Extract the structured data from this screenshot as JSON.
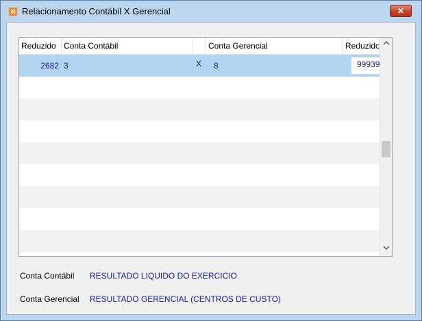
{
  "window": {
    "title": "Relacionamento Contábil X Gerencial",
    "close_label": "✕"
  },
  "grid": {
    "columns": [
      "Reduzido",
      "Conta Contábil",
      "",
      "Conta Gerencial",
      "Reduzido"
    ],
    "selected_row": {
      "reduzido": "2682",
      "conta_contabil": "3",
      "separator": "X",
      "conta_gerencial": "8",
      "reduzido_gerencial": "99939"
    }
  },
  "details": {
    "conta_contabil_label": "Conta Contábil",
    "conta_contabil_value": "RESULTADO LIQUIDO DO EXERCICIO",
    "conta_gerencial_label": "Conta Gerencial",
    "conta_gerencial_value": "RESULTADO GERENCIAL (CENTROS DE CUSTO)"
  },
  "icons": {
    "app": "app-logo-icon",
    "close": "close-icon",
    "scroll_up": "chevron-up-icon",
    "scroll_down": "chevron-down-icon"
  },
  "colors": {
    "selection": "#b3d4f1",
    "value_text": "#1a1ab0",
    "close_button": "#c4442c"
  }
}
